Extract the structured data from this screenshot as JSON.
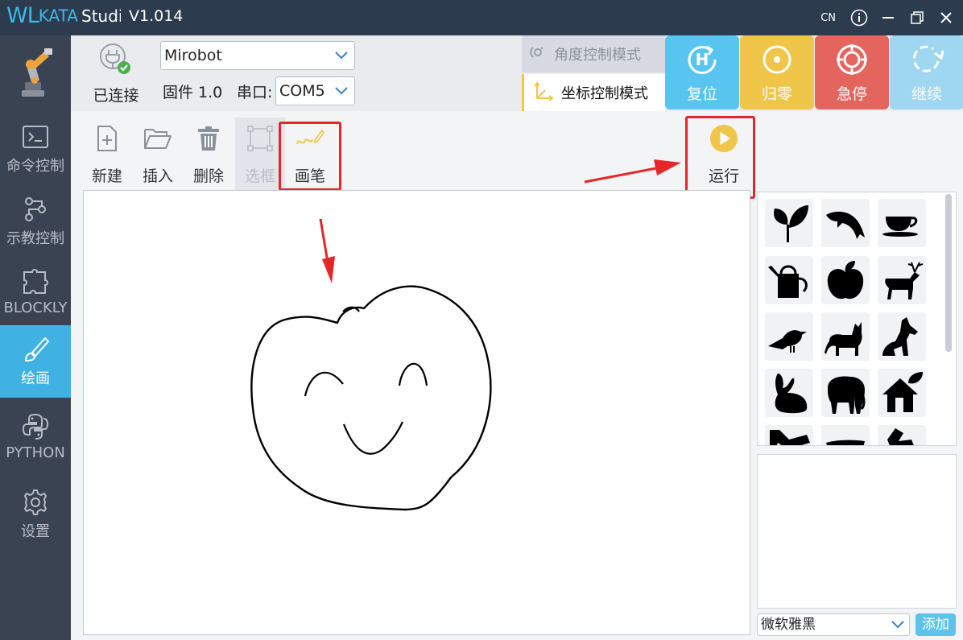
{
  "titlebar": {
    "logo_wl": "WL",
    "logo_kata": "KATA",
    "logo_rest": "Studio",
    "version": "V1.014",
    "lang": "CN"
  },
  "sidebar": {
    "items": [
      {
        "label": "命令控制",
        "icon": "terminal-icon"
      },
      {
        "label": "示教控制",
        "icon": "flow-icon"
      },
      {
        "label": "BLOCKLY",
        "icon": "puzzle-icon"
      },
      {
        "label": "绘画",
        "icon": "brush-icon",
        "active": true
      },
      {
        "label": "PYTHON",
        "icon": "python-icon"
      },
      {
        "label": "设置",
        "icon": "gear-icon"
      }
    ]
  },
  "topbar": {
    "connect_label": "已连接",
    "device": "Mirobot",
    "firmware": "固件 1.0",
    "port_label": "串口:",
    "port_value": "COM5",
    "mode_angle": "角度控制模式",
    "mode_coord": "坐标控制模式",
    "buttons": {
      "reset": "复位",
      "home": "归零",
      "estop": "急停",
      "resume": "继续"
    }
  },
  "toolbar": {
    "new": "新建",
    "insert": "插入",
    "delete": "删除",
    "select": "选框",
    "pen": "画笔",
    "run": "运行"
  },
  "right_panel": {
    "font_value": "微软雅黑",
    "add_label": "添加",
    "shapes": [
      "leaf-shape",
      "dolphin-shape",
      "teacup-shape",
      "watering-can-shape",
      "apple-shape",
      "deer-shape",
      "bird-shape",
      "cat-shape",
      "dog-shape",
      "rabbit-shape",
      "elephant-shape",
      "house-shape",
      "partial-shape-1",
      "partial-shape-2",
      "partial-shape-3"
    ]
  },
  "colors": {
    "titlebar": "#2d3b4f",
    "sidebar": "#3a4352",
    "accent_blue": "#3fb1e3",
    "reset_btn": "#57c5ef",
    "home_btn": "#f0c64a",
    "estop_btn": "#e4655e",
    "resume_btn": "#9fd6f0",
    "highlight_red": "#e5262a",
    "run_yellow": "#f0c64a"
  }
}
